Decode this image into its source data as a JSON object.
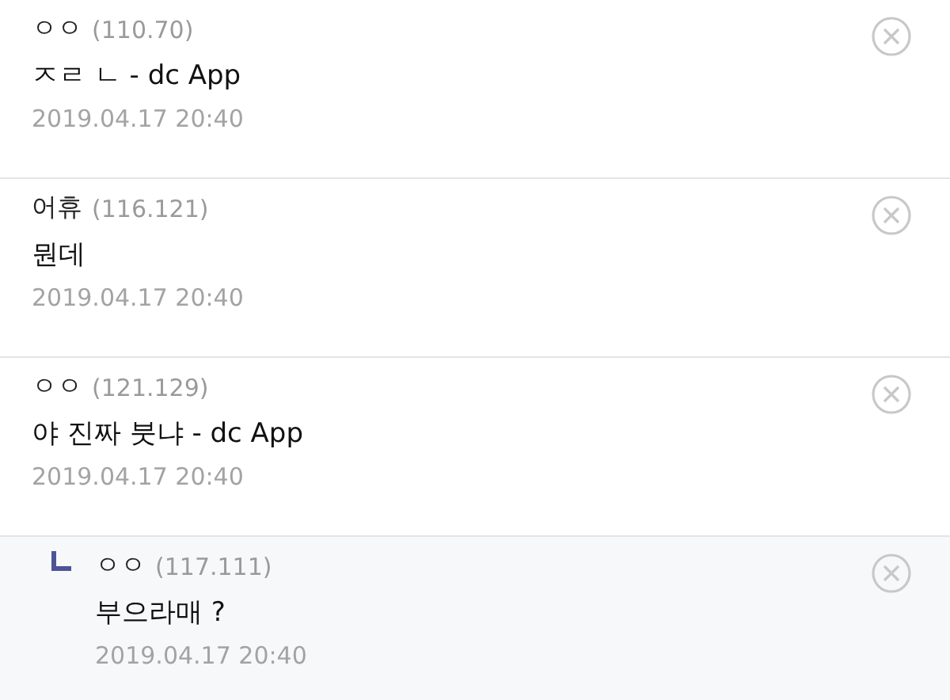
{
  "comments": [
    {
      "kind": "comment",
      "author": "ㅇㅇ",
      "ip": "(110.70)",
      "text": "ㅈㄹ ㄴ - dc App",
      "date": "2019.04.17 20:40"
    },
    {
      "kind": "comment",
      "author": "어휴",
      "ip": "(116.121)",
      "text": "뭔데",
      "date": "2019.04.17 20:40"
    },
    {
      "kind": "comment",
      "author": "ㅇㅇ",
      "ip": "(121.129)",
      "text": "야 진짜 붓냐 - dc App",
      "date": "2019.04.17 20:40"
    },
    {
      "kind": "reply",
      "author": "ㅇㅇ",
      "ip": "(117.111)",
      "text": "부으라매 ?",
      "date": "2019.04.17 20:40"
    }
  ]
}
